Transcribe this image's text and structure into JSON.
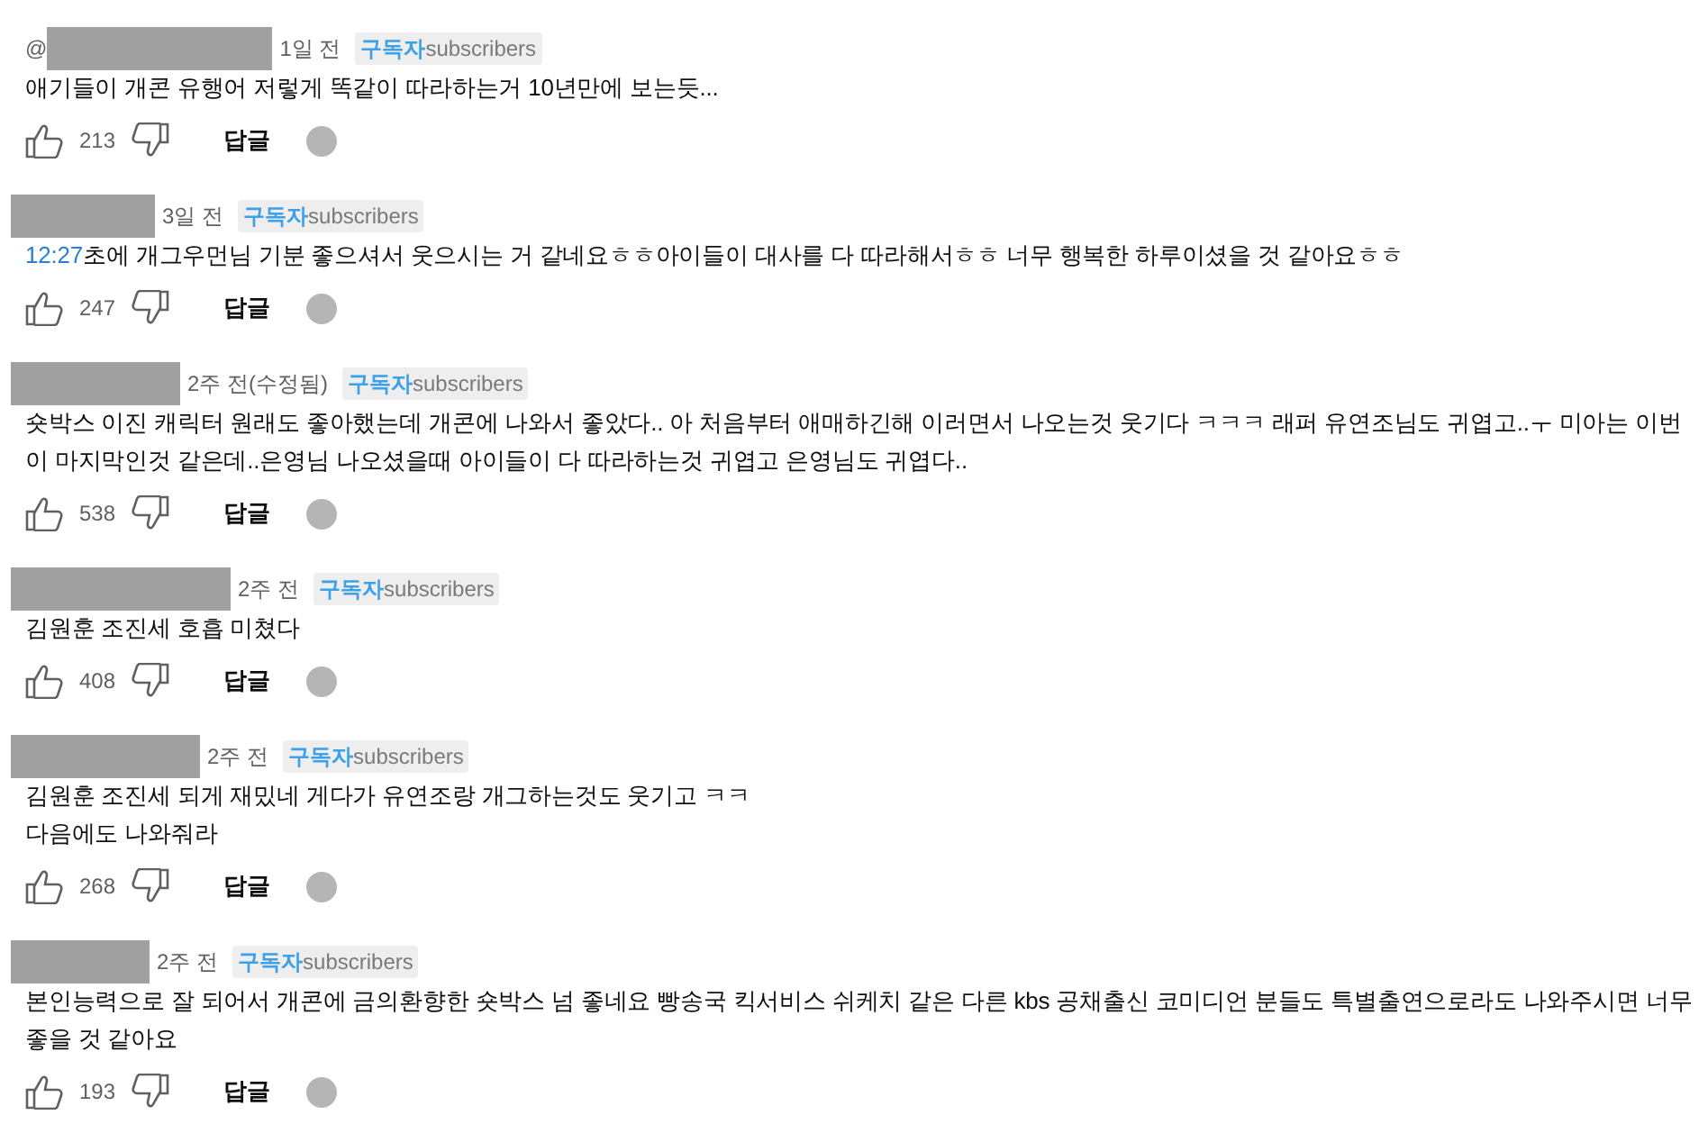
{
  "comments": [
    {
      "prefix": "@",
      "time": "1일 전",
      "badge": "구독자",
      "badge_note": "subscribers",
      "lines": [
        "애기들이 개콘 유행어 저렇게 똑같이 따라하는거 10년만에 보는듯..."
      ],
      "likes": "213",
      "reply": "답글"
    },
    {
      "time": "3일 전",
      "badge": "구독자",
      "badge_note": "subscribers",
      "timestamp": "12:27",
      "lines": [
        "초에 개그우먼님 기분 좋으셔서 웃으시는 거 같네요ㅎㅎ아이들이 대사를 다 따라해서ㅎㅎ 너무 행복한 하루이셨을 것 같아요ㅎㅎ"
      ],
      "likes": "247",
      "reply": "답글"
    },
    {
      "time": "2주 전(수정됨)",
      "badge": "구독자",
      "badge_note": "subscribers",
      "lines": [
        "숏박스 이진 캐릭터 원래도 좋아했는데 개콘에 나와서 좋았다.. 아 처음부터 애매하긴해 이러면서 나오는것 웃기다 ㅋㅋㅋ 래퍼 유연조님도 귀엽고..ㅜ  미아는 이번",
        "이 마지막인것 같은데..은영님 나오셨을때 아이들이 다 따라하는것 귀엽고 은영님도 귀엽다.."
      ],
      "likes": "538",
      "reply": "답글"
    },
    {
      "time": "2주 전",
      "badge": "구독자",
      "badge_note": "subscribers",
      "lines": [
        "김원훈 조진세 호흡 미쳤다"
      ],
      "likes": "408",
      "reply": "답글"
    },
    {
      "time": "2주 전",
      "badge": "구독자",
      "badge_note": "subscribers",
      "lines": [
        "김원훈 조진세 되게 재밌네 게다가 유연조랑 개그하는것도 웃기고 ㅋㅋ",
        "다음에도 나와줘라"
      ],
      "likes": "268",
      "reply": "답글"
    },
    {
      "time": "2주 전",
      "badge": "구독자",
      "badge_note": "subscribers",
      "lines": [
        "본인능력으로 잘 되어서 개콘에 금의환향한 숏박스 넘 좋네요 빵송국 킥서비스 쉬케치 같은 다른 kbs 공채출신 코미디언 분들도 특별출연으로라도 나와주시면 너무",
        "좋을 것 같아요"
      ],
      "likes": "193",
      "reply": "답글"
    }
  ]
}
